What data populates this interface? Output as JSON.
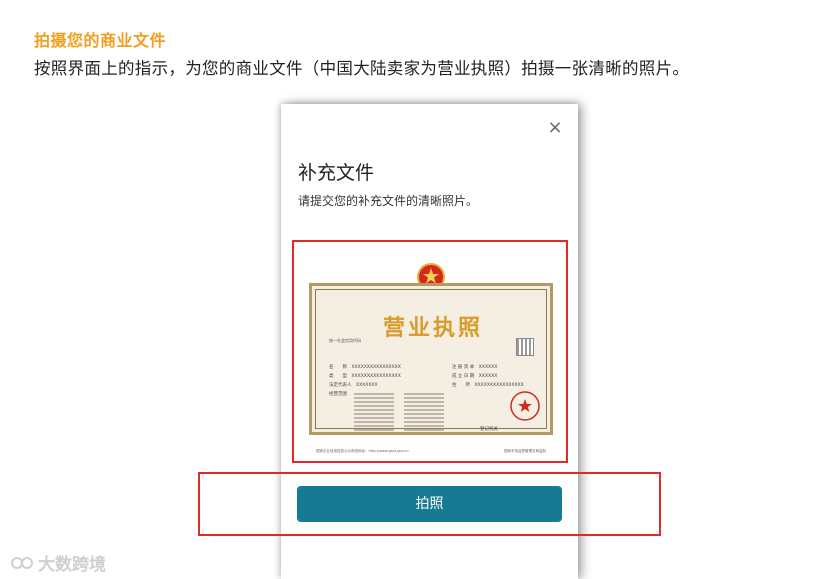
{
  "header": {
    "title": "拍摄您的商业文件",
    "subtitle": "按照界面上的指示，为您的商业文件（中国大陆卖家为营业执照）拍摄一张清晰的照片。"
  },
  "modal": {
    "close_symbol": "×",
    "title": "补充文件",
    "description": "请提交您的补充文件的清晰照片。",
    "action_label": "拍照"
  },
  "license": {
    "title": "营业执照",
    "code_label": "统一社会信用代码",
    "rows_left": [
      {
        "label": "名　　称",
        "value": "XXXXXXXXXXXXXXXX"
      },
      {
        "label": "类　　型",
        "value": "XXXXXXXXXXXXXXXX"
      },
      {
        "label": "法定代表人",
        "value": "XXXXXXX"
      },
      {
        "label": "经营范围",
        "value": ""
      }
    ],
    "rows_right": [
      {
        "label": "注 册 资 本",
        "value": "XXXXXX"
      },
      {
        "label": "成 立 日 期",
        "value": "XXXXXX"
      },
      {
        "label": "住　　所",
        "value": "XXXXXXXXXXXXXXXX"
      }
    ],
    "authority_label": "登记机关",
    "footer_left": "国家企业信用信息公示系统网址：http://www.gsxt.gov.cn",
    "footer_right": "国家市场监督管理总局监制"
  },
  "watermark": {
    "text": "大数跨境"
  },
  "colors": {
    "heading": "#f0a021",
    "button": "#167a93",
    "highlight_box": "#e02a2a"
  }
}
